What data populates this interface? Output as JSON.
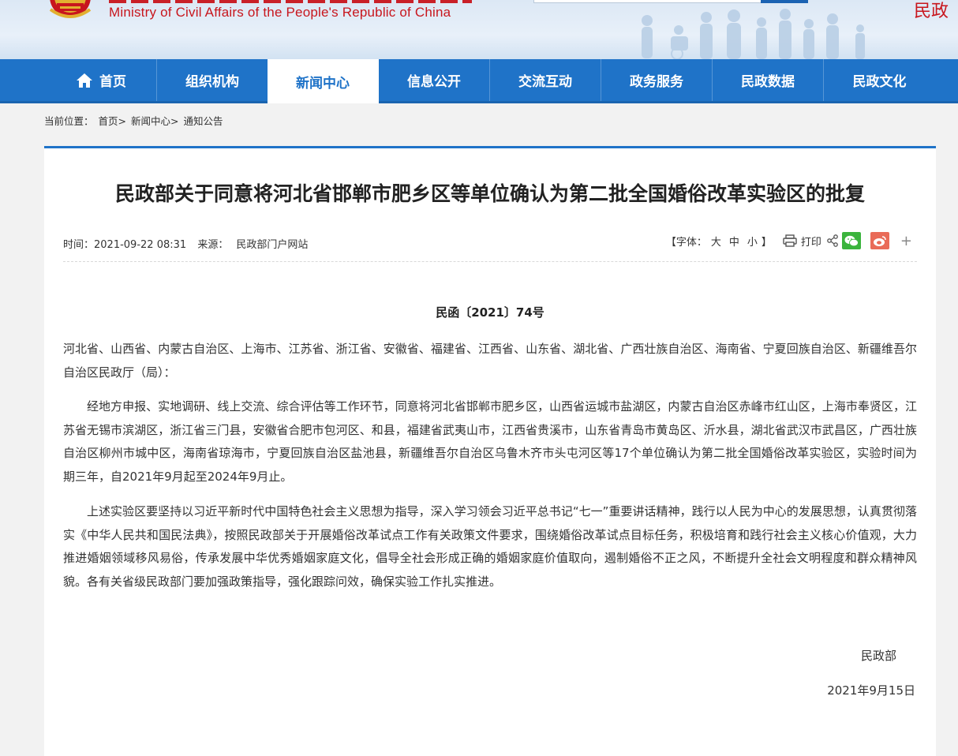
{
  "header": {
    "site_title_en": "Ministry of Civil Affairs of the People's Republic of China",
    "site_title_cn_partial": "民政"
  },
  "nav": {
    "items": [
      {
        "label": "首页",
        "icon": "home-icon"
      },
      {
        "label": "组织机构"
      },
      {
        "label": "新闻中心",
        "active": true
      },
      {
        "label": "信息公开"
      },
      {
        "label": "交流互动"
      },
      {
        "label": "政务服务"
      },
      {
        "label": "民政数据"
      },
      {
        "label": "民政文化"
      }
    ],
    "active_color": "#1f73c8"
  },
  "breadcrumb": {
    "prefix": "当前位置：",
    "items": [
      "首页>",
      "新闻中心>",
      "通知公告"
    ]
  },
  "article": {
    "title": "民政部关于同意将河北省邯郸市肥乡区等单位确认为第二批全国婚俗改革实验区的批复",
    "time_label": "时间：",
    "time": "2021-09-22 08:31",
    "source_label": "来源：",
    "source": "民政部门户网站",
    "font_size_label": "【字体：",
    "font_sizes": [
      "大",
      "中",
      "小"
    ],
    "font_size_close": "】",
    "print_label": "打印",
    "share_more": "+",
    "doc_no": "民函〔2021〕74号",
    "addressee": "河北省、山西省、内蒙古自治区、上海市、江苏省、浙江省、安徽省、福建省、江西省、山东省、湖北省、广西壮族自治区、海南省、宁夏回族自治区、新疆维吾尔自治区民政厅（局）：",
    "paragraph1": "经地方申报、实地调研、线上交流、综合评估等工作环节，同意将河北省邯郸市肥乡区，山西省运城市盐湖区，内蒙古自治区赤峰市红山区，上海市奉贤区，江苏省无锡市滨湖区，浙江省三门县，安徽省合肥市包河区、和县，福建省武夷山市，江西省贵溪市，山东省青岛市黄岛区、沂水县，湖北省武汉市武昌区，广西壮族自治区柳州市城中区，海南省琼海市，宁夏回族自治区盐池县，新疆维吾尔自治区乌鲁木齐市头屯河区等17个单位确认为第二批全国婚俗改革实验区，实验时间为期三年，自2021年9月起至2024年9月止。",
    "paragraph2": "上述实验区要坚持以习近平新时代中国特色社会主义思想为指导，深入学习领会习近平总书记“七一”重要讲话精神，践行以人民为中心的发展思想，认真贯彻落实《中华人民共和国民法典》，按照民政部关于开展婚俗改革试点工作有关政策文件要求，围绕婚俗改革试点目标任务，积极培育和践行社会主义核心价值观，大力推进婚姻领域移风易俗，传承发展中华优秀婚姻家庭文化，倡导全社会形成正确的婚姻家庭价值取向，遏制婚俗不正之风，不断提升全社会文明程度和群众精神风貌。各有关省级民政部门要加强政策指导，强化跟踪问效，确保实验工作扎实推进。",
    "signature": "民政部",
    "sign_date": "2021年9月15日"
  }
}
